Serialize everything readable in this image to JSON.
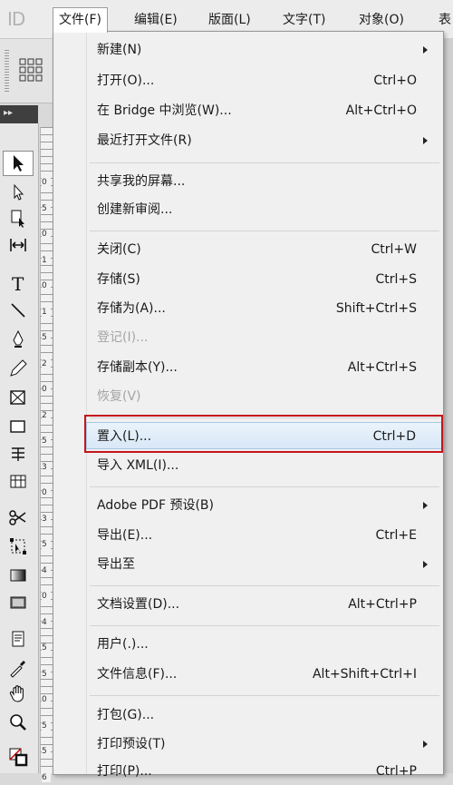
{
  "app": {
    "logo": "ID"
  },
  "menubar": {
    "items": [
      {
        "label": "文件(F)",
        "active": true
      },
      {
        "label": "编辑(E)"
      },
      {
        "label": "版面(L)"
      },
      {
        "label": "文字(T)"
      },
      {
        "label": "对象(O)"
      },
      {
        "label": "表"
      }
    ]
  },
  "ruler": {
    "numbers": [
      "0",
      "5",
      "0",
      "1",
      "0",
      "1",
      "5",
      "2",
      "0",
      "2",
      "5",
      "3",
      "0",
      "3",
      "5",
      "4",
      "0",
      "4",
      "5",
      "5",
      "0",
      "5",
      "5",
      "6"
    ]
  },
  "file_menu": {
    "items": [
      {
        "label": "新建(N)",
        "shortcut": "",
        "submenu": true
      },
      {
        "label": "打开(O)...",
        "shortcut": "Ctrl+O"
      },
      {
        "label": "在 Bridge 中浏览(W)...",
        "shortcut": "Alt+Ctrl+O"
      },
      {
        "label": "最近打开文件(R)",
        "shortcut": "",
        "submenu": true
      },
      {
        "label": "共享我的屏幕...",
        "shortcut": ""
      },
      {
        "label": "创建新审阅...",
        "shortcut": ""
      },
      {
        "label": "关闭(C)",
        "shortcut": "Ctrl+W"
      },
      {
        "label": "存储(S)",
        "shortcut": "Ctrl+S"
      },
      {
        "label": "存储为(A)...",
        "shortcut": "Shift+Ctrl+S"
      },
      {
        "label": "登记(I)...",
        "shortcut": "",
        "disabled": true
      },
      {
        "label": "存储副本(Y)...",
        "shortcut": "Alt+Ctrl+S"
      },
      {
        "label": "恢复(V)",
        "shortcut": "",
        "disabled": true
      },
      {
        "label": "置入(L)...",
        "shortcut": "Ctrl+D",
        "highlighted": true
      },
      {
        "label": "导入 XML(I)...",
        "shortcut": ""
      },
      {
        "label": "Adobe PDF 预设(B)",
        "shortcut": "",
        "submenu": true
      },
      {
        "label": "导出(E)...",
        "shortcut": "Ctrl+E"
      },
      {
        "label": "导出至",
        "shortcut": "",
        "submenu": true
      },
      {
        "label": "文档设置(D)...",
        "shortcut": "Alt+Ctrl+P"
      },
      {
        "label": "用户(.)...",
        "shortcut": ""
      },
      {
        "label": "文件信息(F)...",
        "shortcut": "Alt+Shift+Ctrl+I"
      },
      {
        "label": "打包(G)...",
        "shortcut": ""
      },
      {
        "label": "打印预设(T)",
        "shortcut": "",
        "submenu": true
      },
      {
        "label": "打印(P)...",
        "shortcut": "Ctrl+P"
      }
    ]
  },
  "colors": {
    "highlight_border": "#c4161c",
    "hover_bg": "#d9e8f7"
  }
}
